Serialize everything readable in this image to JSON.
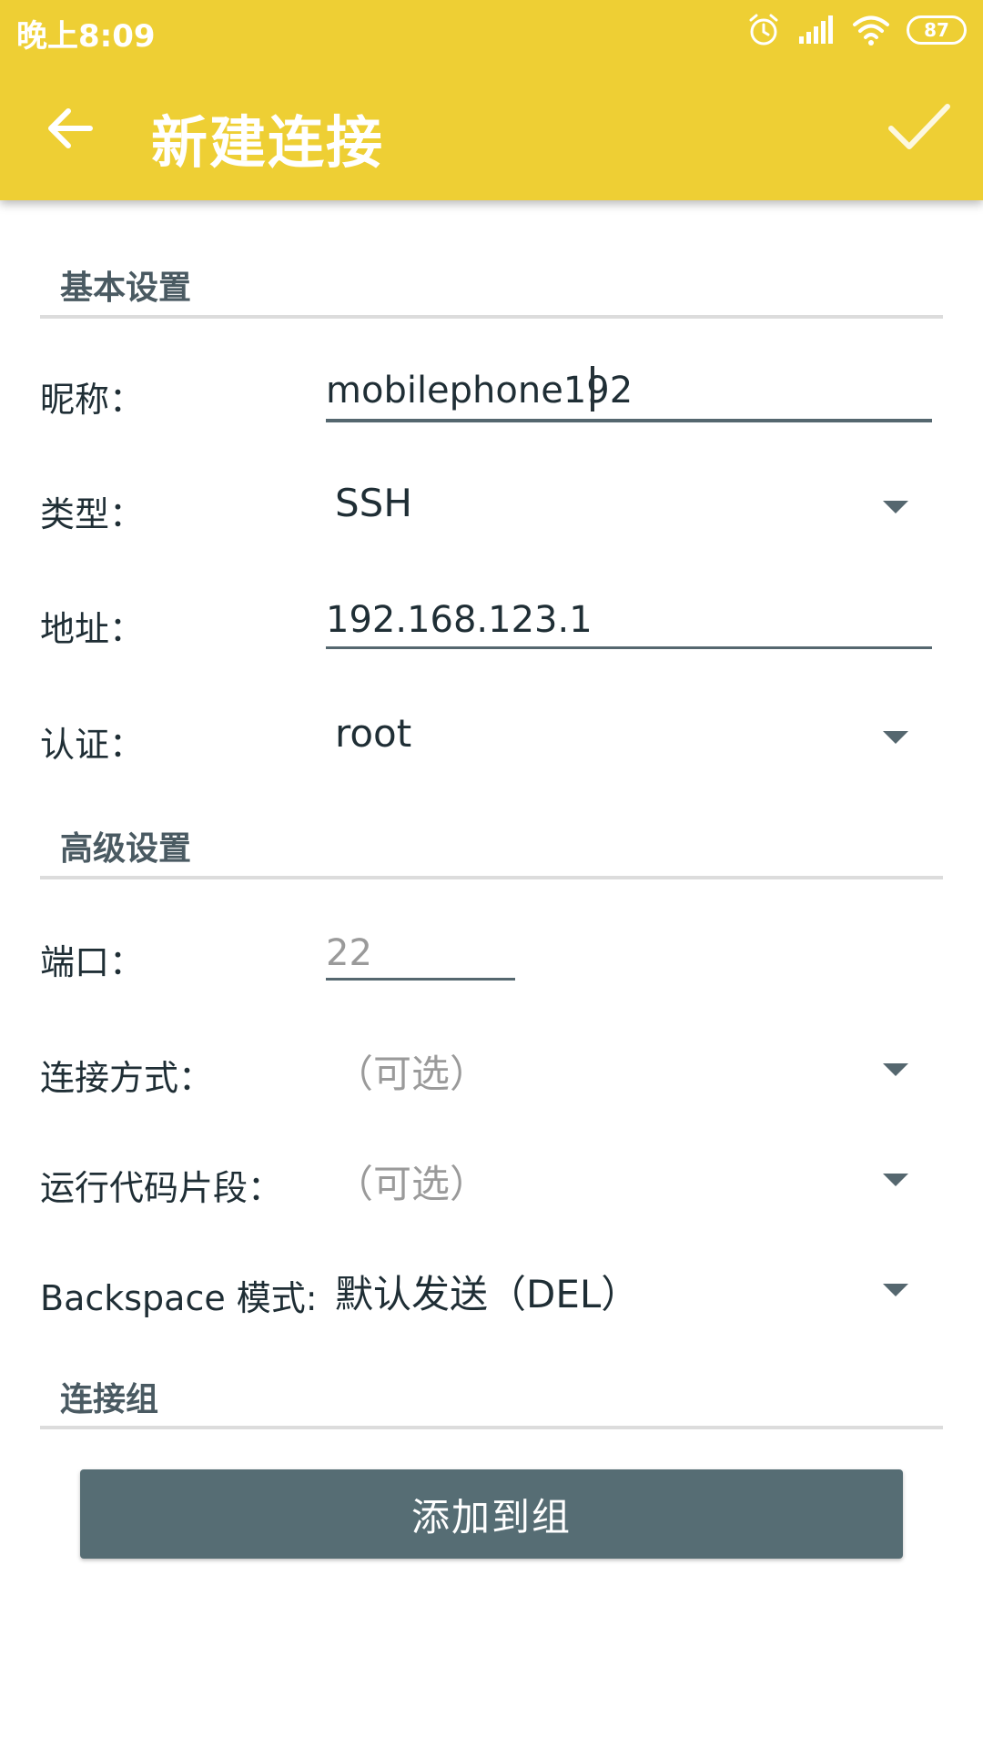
{
  "status_bar": {
    "time": "晚上8:09",
    "battery": "87",
    "icons": [
      "alarm-icon",
      "signal-icon",
      "wifi-icon",
      "battery-icon"
    ]
  },
  "app_bar": {
    "title": "新建连接",
    "back_icon": "arrow-left-icon",
    "confirm_icon": "check-icon",
    "color": "#eecf34"
  },
  "sections": {
    "basic": "基本设置",
    "advanced": "高级设置",
    "group": "连接组"
  },
  "fields": {
    "nickname": {
      "label": "昵称：",
      "value": "mobilephone192"
    },
    "type": {
      "label": "类型：",
      "value": "SSH"
    },
    "address": {
      "label": "地址：",
      "value": "192.168.123.1"
    },
    "auth": {
      "label": "认证：",
      "value": "root"
    },
    "port": {
      "label": "端口：",
      "placeholder": "22"
    },
    "conn_method": {
      "label": "连接方式：",
      "value": "（可选）"
    },
    "snippet": {
      "label": "运行代码片段：",
      "value": "（可选）"
    },
    "backspace": {
      "label": "Backspace 模式:",
      "value": "默认发送（DEL）"
    }
  },
  "add_group_button": "添加到组",
  "button_color": "#566d74"
}
